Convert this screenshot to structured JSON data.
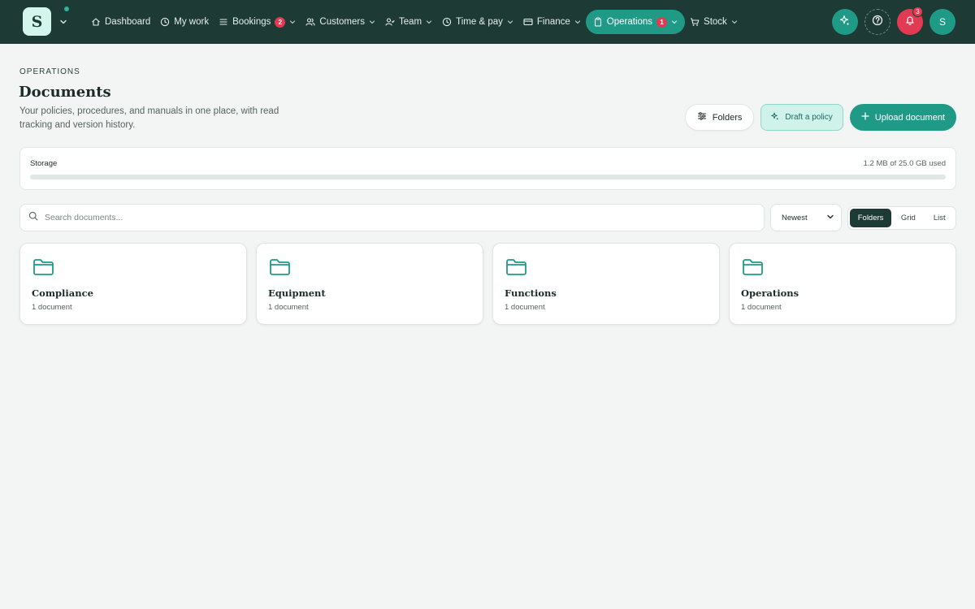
{
  "app": {
    "logo_letter": "S"
  },
  "nav": [
    {
      "label": "Dashboard",
      "icon": "home-icon",
      "has_chevron": false
    },
    {
      "label": "My work",
      "icon": "clock-icon",
      "has_chevron": false
    },
    {
      "label": "Bookings",
      "icon": "list-icon",
      "badge": "2",
      "has_chevron": true
    },
    {
      "label": "Customers",
      "icon": "users-icon",
      "has_chevron": true
    },
    {
      "label": "Team",
      "icon": "team-icon",
      "has_chevron": true
    },
    {
      "label": "Time & pay",
      "icon": "clock-icon",
      "has_chevron": true
    },
    {
      "label": "Finance",
      "icon": "card-icon",
      "has_chevron": true
    },
    {
      "label": "Operations",
      "icon": "clipboard-icon",
      "badge": "1",
      "has_chevron": true,
      "active": true
    },
    {
      "label": "Stock",
      "icon": "cart-icon",
      "has_chevron": true
    }
  ],
  "topbar_right": {
    "notification_count": "3",
    "avatar_letter": "S"
  },
  "page": {
    "eyebrow": "OPERATIONS",
    "title": "Documents",
    "subtitle": "Your policies, procedures, and manuals in one place, with read tracking and version history."
  },
  "actions": {
    "folders_label": "Folders",
    "draft_label": "Draft a policy",
    "upload_label": "Upload document"
  },
  "storage": {
    "label": "Storage",
    "used_text": "1.2 MB of 25.0 GB used",
    "used_fraction": 5e-05
  },
  "search": {
    "placeholder": "Search documents..."
  },
  "sort": {
    "selected": "Newest"
  },
  "view_toggle": {
    "options": [
      "Folders",
      "Grid",
      "List"
    ],
    "selected": "Folders"
  },
  "folders": [
    {
      "name": "Compliance",
      "count": "1 document"
    },
    {
      "name": "Equipment",
      "count": "1 document"
    },
    {
      "name": "Functions",
      "count": "1 document"
    },
    {
      "name": "Operations",
      "count": "1 document"
    }
  ],
  "colors": {
    "topbar": "#1d3a35",
    "accent": "#1f9a86",
    "danger": "#e23a53",
    "background": "#f3f5f4"
  }
}
